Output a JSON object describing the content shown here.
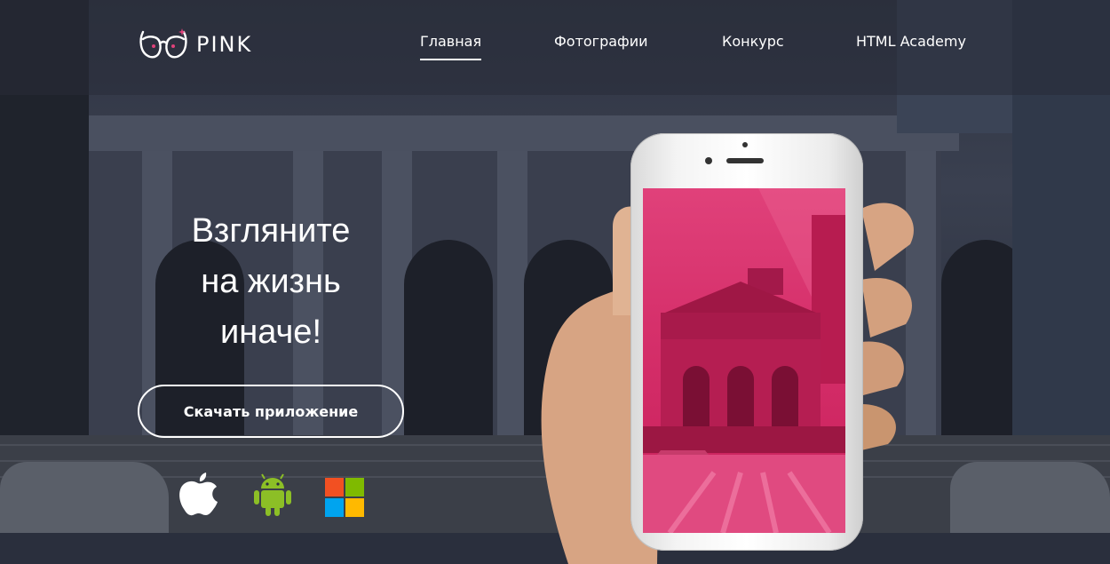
{
  "brand": {
    "logo_word": "PINK"
  },
  "nav": {
    "items": [
      {
        "label": "Главная"
      },
      {
        "label": "Фотографии"
      },
      {
        "label": "Конкурс"
      },
      {
        "label": "HTML Academy"
      }
    ]
  },
  "hero": {
    "headline_line1": "Взгляните",
    "headline_line2": "на жизнь",
    "headline_line3": "иначе!",
    "cta_label": "Скачать приложение"
  },
  "stores": {
    "icons": [
      "apple-icon",
      "android-icon",
      "windows-icon"
    ]
  },
  "colors": {
    "accent": "#e0417a",
    "android_green": "#8cbf26",
    "ms_red": "#f25022",
    "ms_green": "#7fba00",
    "ms_blue": "#00a4ef",
    "ms_yellow": "#ffb900"
  }
}
